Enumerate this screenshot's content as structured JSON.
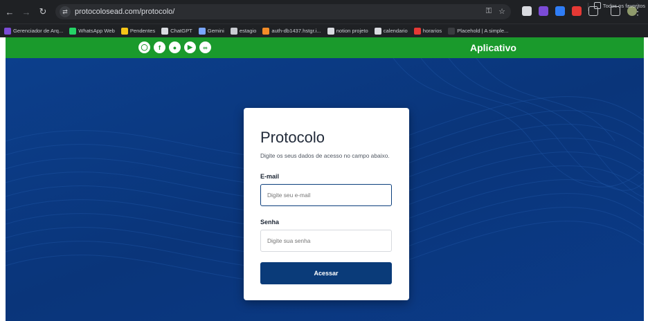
{
  "browser": {
    "url": "protocolosead.com/protocolo/",
    "bookmarks": [
      {
        "label": "Gerenciador de Arq...",
        "color": "#7b4bd6"
      },
      {
        "label": "WhatsApp Web",
        "color": "#25d366"
      },
      {
        "label": "Pendentes",
        "color": "#f5c518"
      },
      {
        "label": "ChatGPT",
        "color": "#d9dbe0"
      },
      {
        "label": "Gemini",
        "color": "#7aa7ff"
      },
      {
        "label": "estagio",
        "color": "#c9ccd1"
      },
      {
        "label": "auth-db1437.hstgr.i...",
        "color": "#f28c28"
      },
      {
        "label": "notion projeto",
        "color": "#d9dbe0"
      },
      {
        "label": "calendario",
        "color": "#d9dbe0"
      },
      {
        "label": "horarios",
        "color": "#e53935"
      },
      {
        "label": "Placehold | A simple...",
        "color": "#3a3c40"
      }
    ],
    "all_bookmarks": "Todos os favoritos"
  },
  "header": {
    "app_link": "Aplicativo",
    "social_icons": [
      "instagram-icon",
      "facebook-icon",
      "twitter-icon",
      "youtube-icon",
      "link-icon"
    ],
    "accent": "#1a9a2c"
  },
  "login": {
    "title": "Protocolo",
    "subtitle": "Digite os seus dados de acesso no campo abaixo.",
    "email_label": "E-mail",
    "email_placeholder": "Digite seu e-mail",
    "password_label": "Senha",
    "password_placeholder": "Digite sua senha",
    "submit": "Acessar",
    "button_color": "#0a3b79"
  }
}
